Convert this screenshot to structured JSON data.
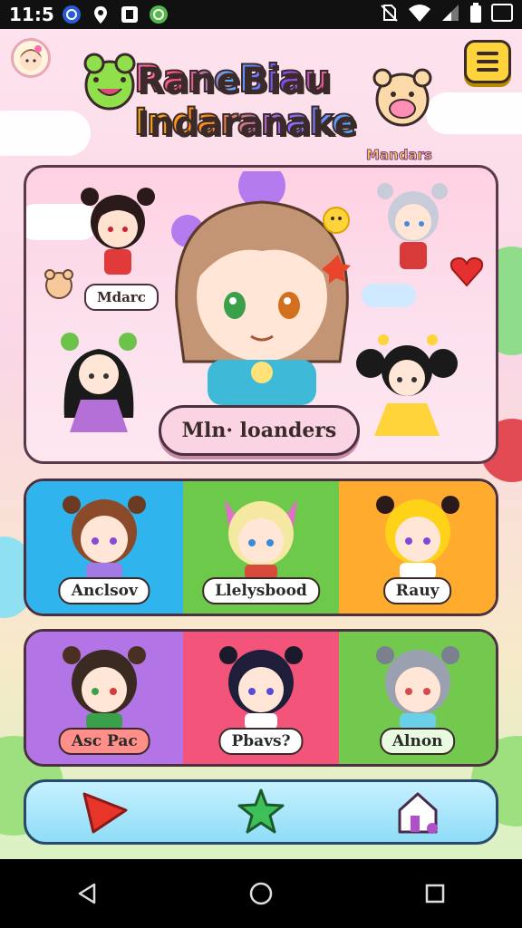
{
  "status_bar": {
    "time": "11:5",
    "icons": [
      "sync-icon",
      "location-icon",
      "app-icon",
      "game-icon"
    ],
    "right_icons": [
      "no-sim-icon",
      "wifi-icon",
      "signal-icon",
      "battery-icon"
    ]
  },
  "header": {
    "title_line1": "RaneBiau",
    "title_line2": "Indaranake",
    "subtitle": "Mandars",
    "menu_icon": "hamburger-icon",
    "avatar_icon": "avatar-icon"
  },
  "feature": {
    "left_tag": "Mdarc",
    "main_button": "Mln· loanders"
  },
  "grid_row1": [
    {
      "label": "Anclsov",
      "bg": "#2fb4ee"
    },
    {
      "label": "Llelysbood",
      "bg": "#6cc94a"
    },
    {
      "label": "Rauy",
      "bg": "#ffab2e"
    }
  ],
  "grid_row2": [
    {
      "label": "Asc Pac",
      "bg": "#b374e6"
    },
    {
      "label": "Pbavs?",
      "bg": "#f2547a"
    },
    {
      "label": "Alnon",
      "bg": "#72c94e"
    }
  ],
  "bottom_nav": {
    "items": [
      "play-icon",
      "star-icon",
      "home-icon"
    ]
  },
  "system_nav": [
    "back-icon",
    "home-circle-icon",
    "recents-icon"
  ],
  "colors": {
    "accent_pink": "#ff6fae",
    "accent_yellow": "#ffd43b",
    "nav_blue": "#8fdcf7"
  }
}
